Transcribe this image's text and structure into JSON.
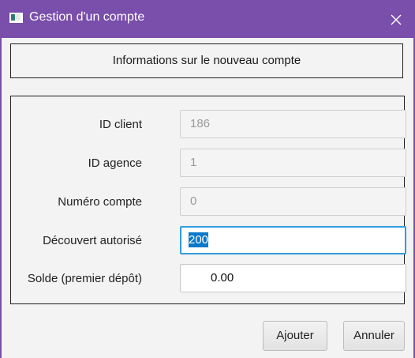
{
  "window": {
    "title": "Gestion d'un compte",
    "title_bar_color": "#7a4eab"
  },
  "header_panel": {
    "text": "Informations sur le nouveau compte"
  },
  "form": {
    "fields": [
      {
        "label": "ID client",
        "value": "186",
        "editable": false
      },
      {
        "label": "ID agence",
        "value": "1",
        "editable": false
      },
      {
        "label": "Numéro compte",
        "value": "0",
        "editable": false
      },
      {
        "label": "Découvert autorisé",
        "value": "200",
        "editable": true,
        "focused": true,
        "text_selected": true
      },
      {
        "label": "Solde (premier dépôt)",
        "value": "0.00",
        "editable": true
      }
    ]
  },
  "buttons": {
    "add_label": "Ajouter",
    "cancel_label": "Annuler"
  },
  "icons": {
    "window_icon": "app-window-icon",
    "close_icon": "close-icon"
  },
  "colors": {
    "focus_border": "#2f9ce0",
    "selection": "#0b78c8"
  }
}
